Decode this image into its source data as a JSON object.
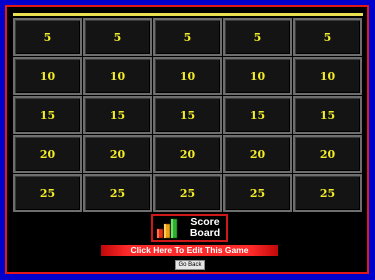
{
  "board": {
    "columns": 5,
    "rows": [
      [
        "5",
        "5",
        "5",
        "5",
        "5"
      ],
      [
        "10",
        "10",
        "10",
        "10",
        "10"
      ],
      [
        "15",
        "15",
        "15",
        "15",
        "15"
      ],
      [
        "20",
        "20",
        "20",
        "20",
        "20"
      ],
      [
        "25",
        "25",
        "25",
        "25",
        "25"
      ]
    ]
  },
  "scoreboard": {
    "line1": "Score",
    "line2": "Board",
    "icon": "bar-chart-icon"
  },
  "edit_button": {
    "label": "Click Here To Edit This Game"
  },
  "go_back_button": {
    "label": "Go Back"
  },
  "colors": {
    "background": "#0000cc",
    "border": "#e01818",
    "tile_text": "#f4ee2a",
    "tile_bg": "#141414",
    "header_line": "#e8e050"
  }
}
